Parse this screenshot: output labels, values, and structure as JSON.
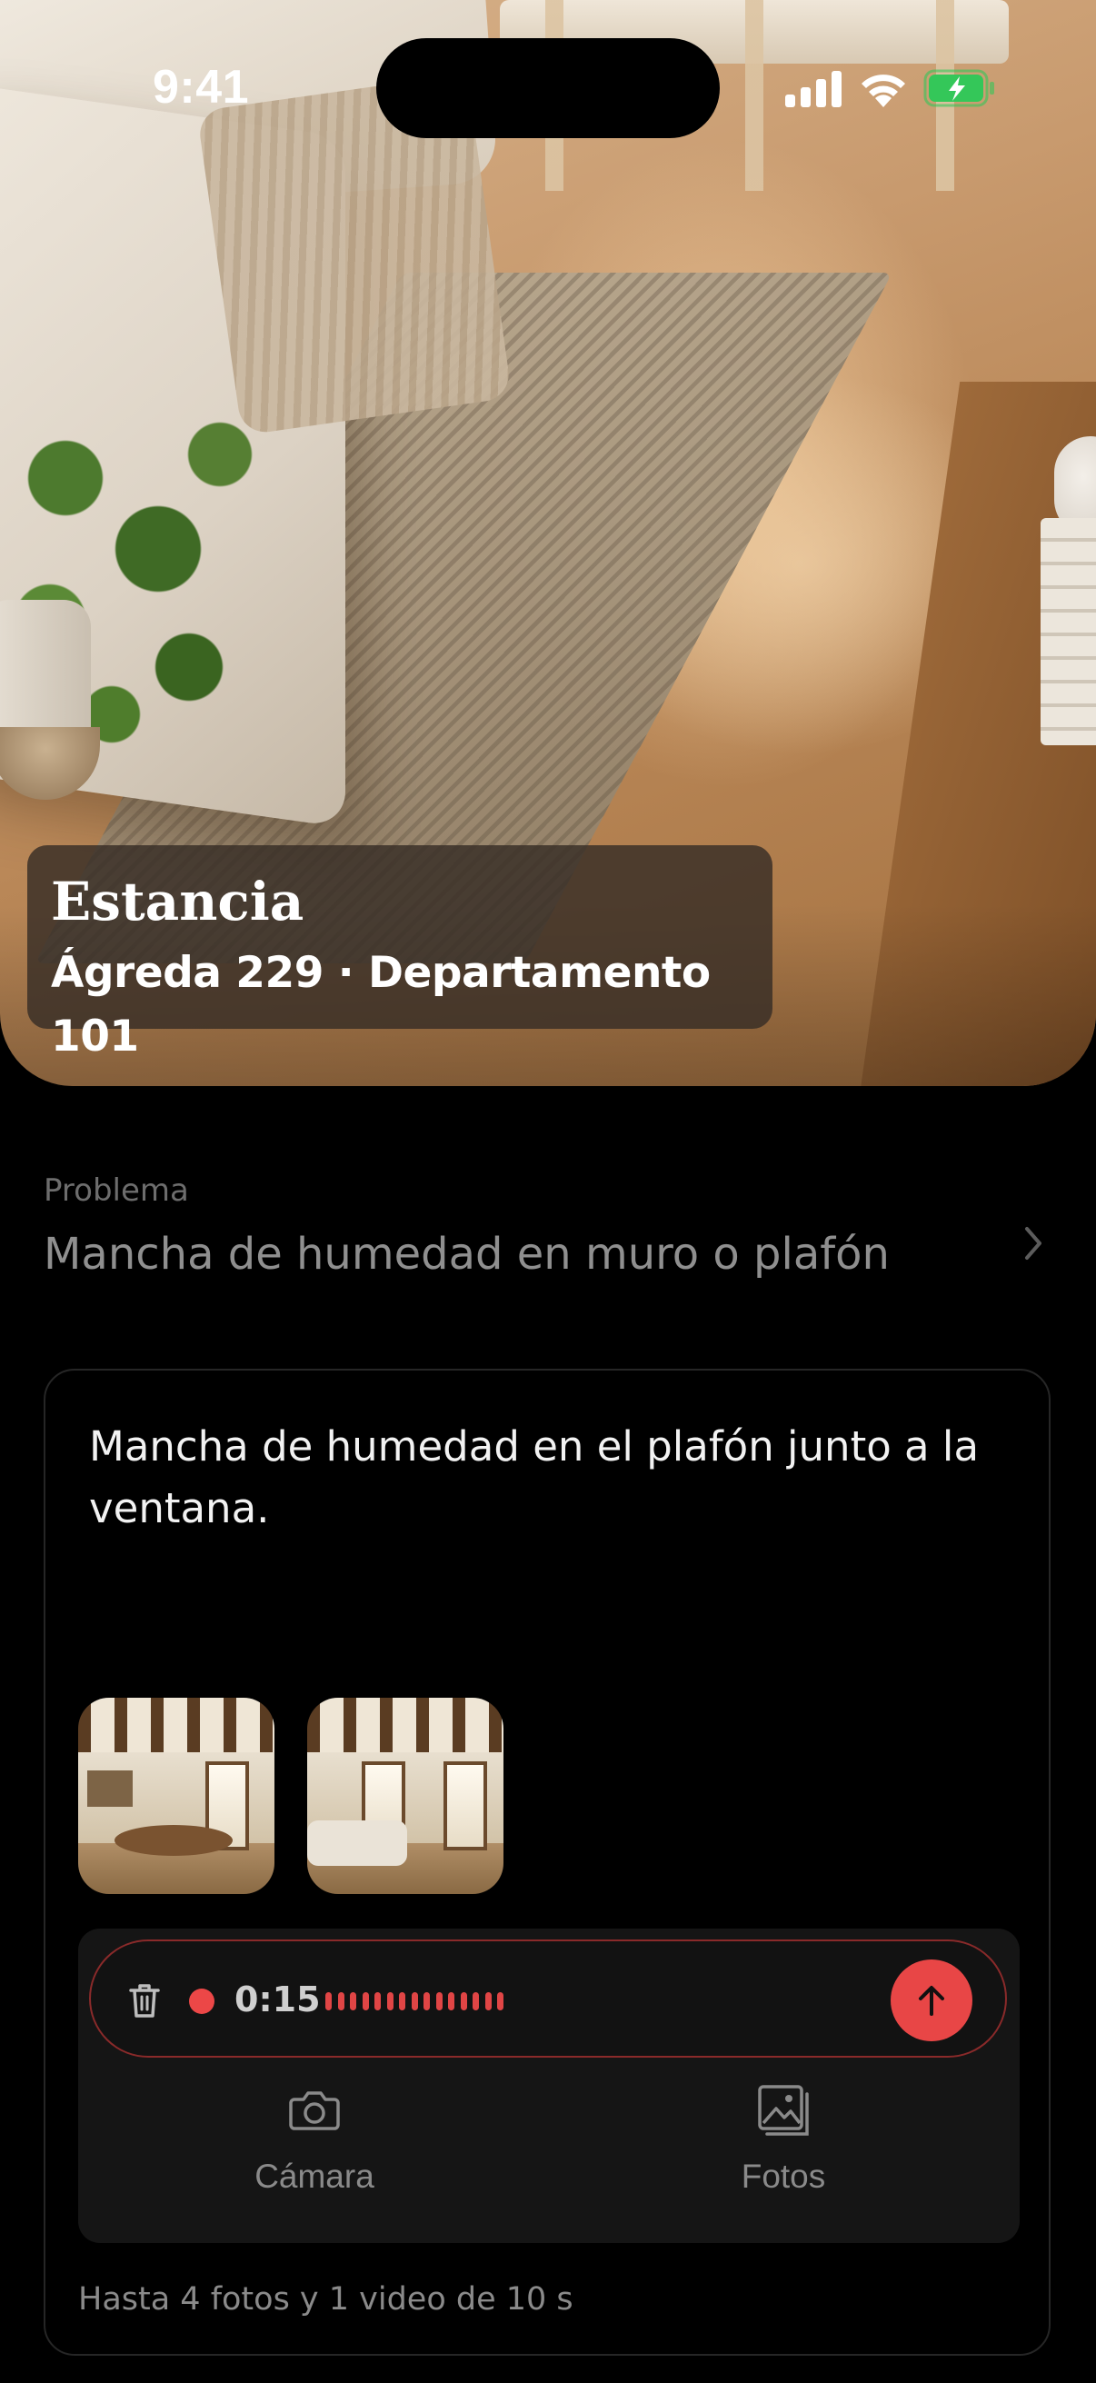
{
  "status_bar": {
    "time": "9:41",
    "signal_icon": "cellular-signal-icon",
    "wifi_icon": "wifi-icon",
    "battery_icon": "battery-charging-icon",
    "battery_color": "#34c759"
  },
  "hero": {
    "image_name": "living-room-photo",
    "room_name": "Estancia",
    "property_name": "Ágreda 229 · Departamento 101"
  },
  "problem": {
    "label": "Problema",
    "value": "Mancha de humedad en muro o plafón",
    "chevron_icon": "chevron-right-icon"
  },
  "report": {
    "description": "Mancha de humedad en el plafón junto a la ventana.",
    "thumbnails": [
      {
        "name": "dining-room-photo"
      },
      {
        "name": "living-room-photo"
      }
    ],
    "recording": {
      "time": "0:15",
      "trash_icon": "trash-icon",
      "send_icon": "arrow-up-icon",
      "accent": "#e84646"
    },
    "actions": [
      {
        "label": "Cámara",
        "icon": "camera-icon"
      },
      {
        "label": "Fotos",
        "icon": "photos-icon"
      }
    ],
    "limits": "Hasta 4 fotos y 1 video de 10 s"
  }
}
